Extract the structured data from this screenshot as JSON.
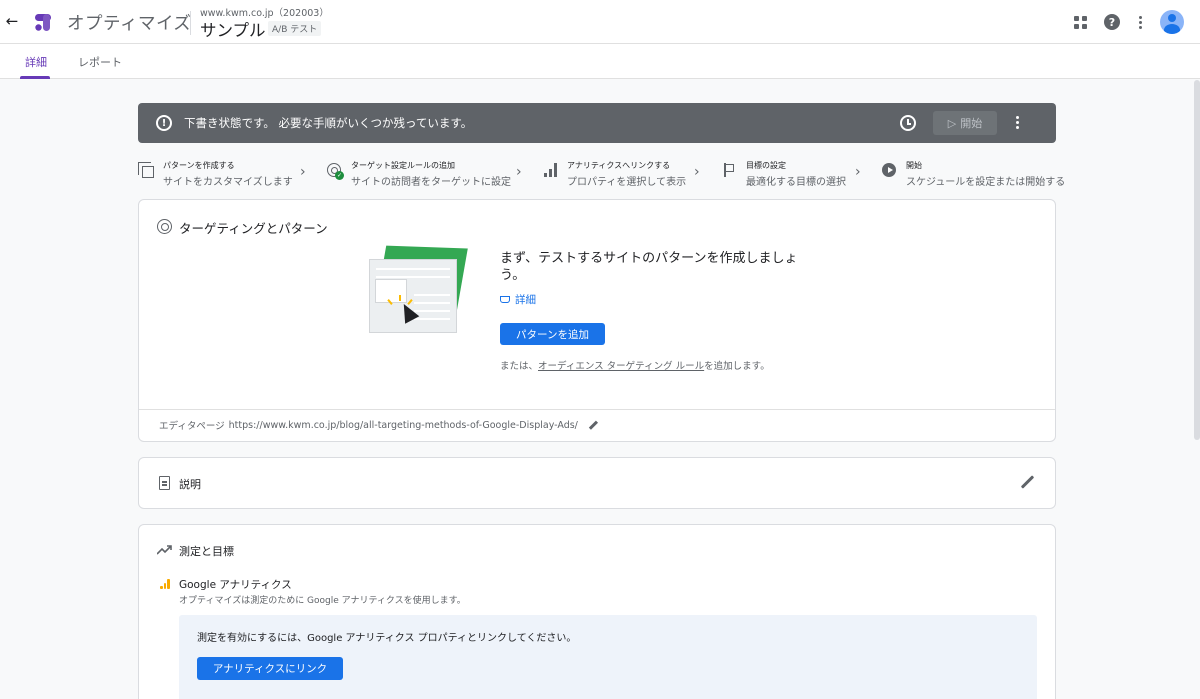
{
  "header": {
    "back_icon": "arrow-back-icon",
    "app_name": "オプティマイズ",
    "account": "www.kwm.co.jp（202003）",
    "experience_name": "サンプル",
    "experience_type": "A/B テスト",
    "icons": [
      "apps-icon",
      "help-icon",
      "more-vert-icon",
      "account-avatar"
    ]
  },
  "tabs": [
    {
      "label": "詳細",
      "active": true
    },
    {
      "label": "レポート",
      "active": false
    }
  ],
  "banner": {
    "message": "下書き状態です。 必要な手順がいくつか残っています。",
    "start_label": "開始",
    "color": "#5f6368"
  },
  "steps": [
    {
      "title": "パターンを作成する",
      "subtitle": "サイトをカスタマイズします",
      "icon": "copy-icon"
    },
    {
      "title": "ターゲット設定ルールの追加",
      "subtitle": "サイトの訪問者をターゲットに設定",
      "icon": "target-check-icon"
    },
    {
      "title": "アナリティクスへリンクする",
      "subtitle": "プロパティを選択して表示",
      "icon": "analytics-icon"
    },
    {
      "title": "目標の設定",
      "subtitle": "最適化する目標の選択",
      "icon": "flag-icon"
    },
    {
      "title": "開始",
      "subtitle": "スケジュールを設定または開始する",
      "icon": "play-icon"
    }
  ],
  "targeting_card": {
    "title": "ターゲティングとパターン",
    "lead": "まず、テストするサイトのパターンを作成しましょう。",
    "learn_more": "詳細",
    "add_variant_button": "パターンを追加",
    "or_prefix": "または、",
    "or_link": "オーディエンス ターゲティング ルール",
    "or_suffix": "を追加します。",
    "editor_label": "エディタページ",
    "editor_url": "https://www.kwm.co.jp/blog/all-targeting-methods-of-Google-Display-Ads/"
  },
  "description_card": {
    "title": "説明"
  },
  "measurement_card": {
    "title": "測定と目標",
    "ga_title": "Google アナリティクス",
    "ga_subtitle": "オプティマイズは測定のために Google アナリティクスを使用します。",
    "info_message": "測定を有効にするには、Google アナリティクス プロパティとリンクしてください。",
    "link_button": "アナリティクスにリンク"
  },
  "colors": {
    "accent": "#673ab7",
    "primary": "#1a73e8",
    "banner": "#5f6368",
    "success": "#1e8e3e",
    "analytics": "#f9ab00"
  }
}
